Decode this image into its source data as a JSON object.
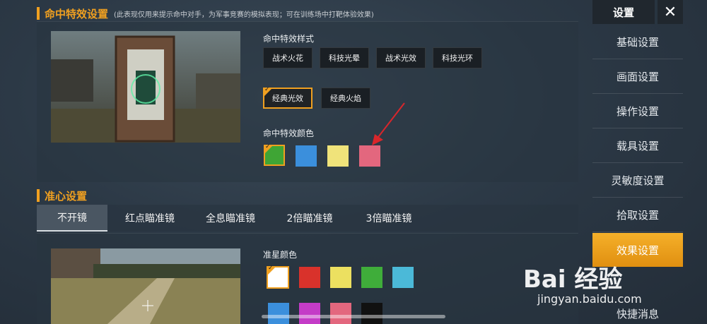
{
  "hit_effect_section": {
    "title": "命中特效设置",
    "note": "(此表现仅用来提示命中对手，为军事竞赛的模拟表现；可在训练场中打靶体验效果)",
    "style_label": "命中特效样式",
    "style_options": [
      "战术火花",
      "科技光晕",
      "战术光效",
      "科技光环"
    ],
    "style_options_row2": [
      "经典光效",
      "经典火焰"
    ],
    "selected_style": "经典光效",
    "color_label": "命中特效颜色",
    "colors": [
      "#3fa535",
      "#3b8fdc",
      "#f0e37a",
      "#e3677e"
    ],
    "selected_color_index": 0
  },
  "crosshair_section": {
    "title": "准心设置",
    "tabs": [
      "不开镜",
      "红点瞄准镜",
      "全息瞄准镜",
      "2倍瞄准镜",
      "3倍瞄准镜"
    ],
    "active_tab": "不开镜",
    "color_label": "准星颜色",
    "colors_row1": [
      "#ffffff",
      "#d9322b",
      "#ece060",
      "#3fad3a",
      "#4bb9d8"
    ],
    "colors_row2": [
      "#3b8fdc",
      "#c43cc7",
      "#e3677e",
      "#111111"
    ],
    "selected_color_index": 0
  },
  "sidebar": {
    "title": "设置",
    "close_icon": "close-icon",
    "items": [
      "基础设置",
      "画面设置",
      "操作设置",
      "载具设置",
      "灵敏度设置",
      "拾取设置",
      "效果设置",
      "快捷消息"
    ],
    "active": "效果设置"
  },
  "watermark": {
    "logo": "Bai 经验",
    "url": "jingyan.baidu.com"
  },
  "annotation": {
    "arrow_color": "#d9262b"
  }
}
